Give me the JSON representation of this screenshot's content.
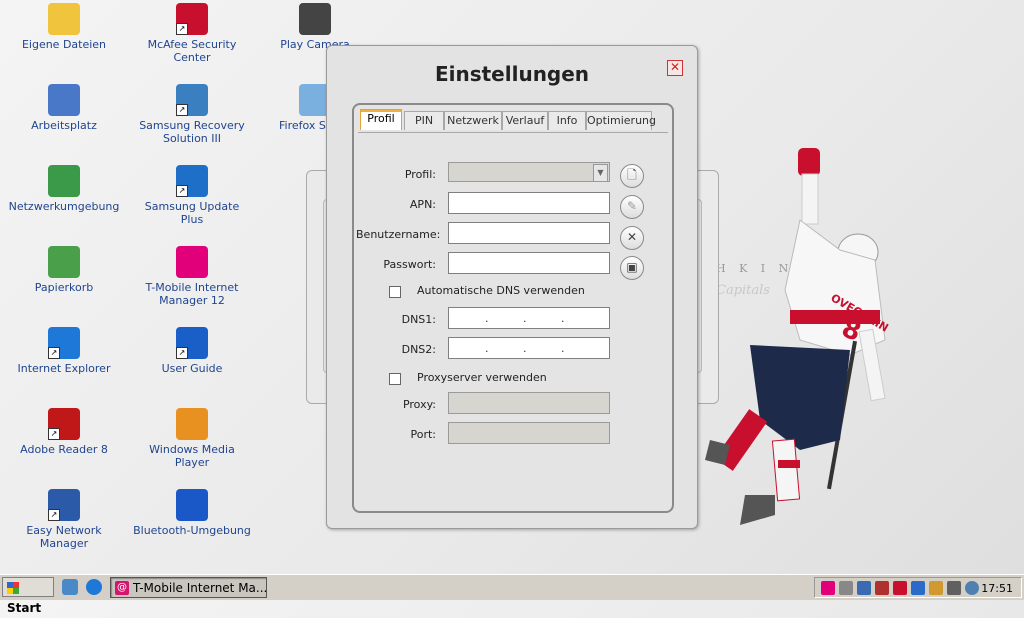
{
  "desktop": {
    "icons": [
      {
        "label": "Eigene Dateien",
        "icon": "folder-icon",
        "color": "#f0c43c"
      },
      {
        "label": "McAfee Security Center",
        "icon": "mcafee-icon",
        "color": "#c8102e"
      },
      {
        "label": "Play Camera",
        "icon": "camera-icon",
        "color": "#444444"
      },
      {
        "label": "Arbeitsplatz",
        "icon": "computer-icon",
        "color": "#4a78c8"
      },
      {
        "label": "Samsung Recovery Solution III",
        "icon": "recovery-icon",
        "color": "#3a7fc0"
      },
      {
        "label": "Firefox Setup",
        "icon": "firefox-icon",
        "color": "#7ab0e0"
      },
      {
        "label": "Netzwerkumgebung",
        "icon": "network-icon",
        "color": "#3a9a4a"
      },
      {
        "label": "Samsung Update Plus",
        "icon": "update-icon",
        "color": "#1e6fc8"
      },
      {
        "label": "Papierkorb",
        "icon": "recycle-bin-icon",
        "color": "#4aa04a"
      },
      {
        "label": "T-Mobile Internet Manager 12",
        "icon": "tmobile-icon",
        "color": "#e2007a"
      },
      {
        "label": "Internet Explorer",
        "icon": "ie-icon",
        "color": "#1e78d8"
      },
      {
        "label": "User Guide",
        "icon": "user-guide-icon",
        "color": "#1a5fc8"
      },
      {
        "label": "Adobe Reader 8",
        "icon": "adobe-reader-icon",
        "color": "#c01818"
      },
      {
        "label": "Windows Media Player",
        "icon": "media-player-icon",
        "color": "#e89020"
      },
      {
        "label": "Easy Network Manager",
        "icon": "easy-network-icon",
        "color": "#2a5aa8"
      },
      {
        "label": "Bluetooth-Umgebung",
        "icon": "bluetooth-icon",
        "color": "#1a58c8"
      }
    ],
    "wallpaper_text_top": "H K I N",
    "wallpaper_text_logo": "Capitals",
    "jersey_name": "OVECHKIN",
    "jersey_number": "8"
  },
  "dialog": {
    "title": "Einstellungen",
    "tabs": [
      "Profil",
      "PIN",
      "Netzwerk",
      "Verlauf",
      "Info",
      "Optimierung"
    ],
    "active_tab": "Profil",
    "fields": {
      "profil_label": "Profil:",
      "apn_label": "APN:",
      "benutzername_label": "Benutzername:",
      "passwort_label": "Passwort:",
      "dns_checkbox_label": "Automatische DNS verwenden",
      "dns1_label": "DNS1:",
      "dns2_label": "DNS2:",
      "proxy_checkbox_label": "Proxyserver verwenden",
      "proxy_label": "Proxy:",
      "port_label": "Port:"
    },
    "values": {
      "profil": "",
      "apn": "",
      "benutzername": "",
      "passwort": "",
      "dns1": "",
      "dns2": "",
      "proxy": "",
      "port": ""
    },
    "ip_separator": "."
  },
  "taskbar": {
    "start_label": "Start",
    "task_label": "T-Mobile Internet Ma...",
    "clock": "17:51"
  },
  "colors": {
    "accent_tab": "#e4a33a",
    "brand_magenta": "#e2007a",
    "caps_red": "#c8102e",
    "caps_navy": "#1e2a4a"
  }
}
